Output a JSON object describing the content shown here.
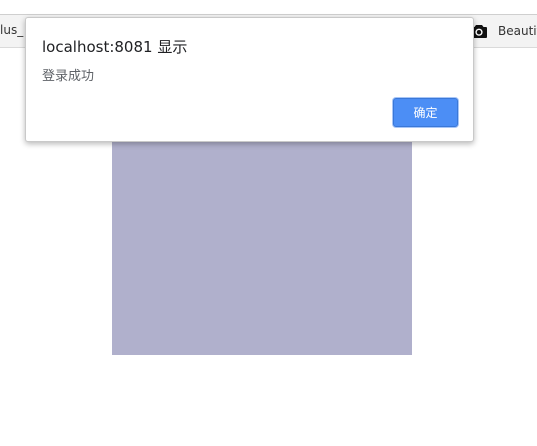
{
  "bookmarks": {
    "left_partial_label": "lus_",
    "right_icon": "camera-icon",
    "right_label": "Beautif"
  },
  "dialog": {
    "title": "localhost:8081 显示",
    "message": "登录成功",
    "ok_label": "确定"
  },
  "colors": {
    "page_background": "#ffffff",
    "purple_box": "#b0b0cc",
    "ok_button": "#4c8ef5"
  }
}
